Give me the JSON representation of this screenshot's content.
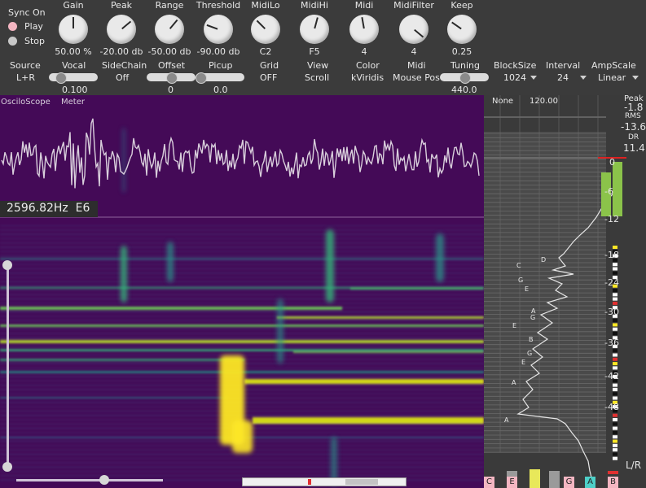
{
  "sync": {
    "title": "Sync On",
    "play": "Play",
    "stop": "Stop"
  },
  "knobs": [
    {
      "name": "Gain",
      "value": "50.00 %",
      "angle": 0
    },
    {
      "name": "Peak",
      "value": "-20.00 db",
      "angle": 50
    },
    {
      "name": "Range",
      "value": "-50.00 db",
      "angle": 40
    },
    {
      "name": "Threshold",
      "value": "-90.00 db",
      "angle": -70
    },
    {
      "name": "MidiLo",
      "value": "C2",
      "angle": -45
    },
    {
      "name": "MidiHi",
      "value": "F5",
      "angle": 15
    },
    {
      "name": "Midi",
      "value": "4",
      "angle": -10
    },
    {
      "name": "MidiFilter",
      "value": "4",
      "angle": 130
    },
    {
      "name": "Keep",
      "value": "0.25",
      "angle": -55
    }
  ],
  "row2": {
    "source_label": "Source",
    "source_value": "L+R",
    "vocal_label": "Vocal",
    "vocal_value": "0.100",
    "vocal_level": 0.1,
    "sidechain_label": "SideChain",
    "sidechain_value": "Off",
    "offset_label": "Offset",
    "offset_value": "0",
    "offset_level": 0.5,
    "picup_label": "Picup",
    "picup_value": "0.0",
    "picup_level": 0.0,
    "grid_label": "Grid",
    "grid_value": "OFF",
    "view_label": "View",
    "view_value": "Scroll",
    "color_label": "Color",
    "color_value": "kViridis",
    "midi_label": "Midi",
    "midi_value": "Mouse Pos",
    "tuning_label": "Tuning",
    "tuning_value": "440.0",
    "tuning_level": 0.5,
    "blocksize_label": "BlockSize",
    "blocksize_value": "1024",
    "interval_label": "Interval",
    "interval_value": "24",
    "ampscale_label": "AmpScale",
    "ampscale_value": "Linear"
  },
  "tabs": {
    "oscilloscope": "OsciloScope",
    "meter": "Meter"
  },
  "readout": "2596.82Hz  E6",
  "meter_header": {
    "none": "None",
    "bpm": "120.00"
  },
  "stats": {
    "peak_label": "Peak",
    "peak_value": "-1.8",
    "rms_label": "RMS",
    "rms_value": "-13.6",
    "dr_label": "DR",
    "dr_value": "11.4"
  },
  "db_scale": [
    "0",
    "-6",
    "-12",
    "-18",
    "-24",
    "-30",
    "-36",
    "-42",
    "-48"
  ],
  "channel_label": "L/R",
  "note_curve_labels": [
    "D",
    "C",
    "G",
    "E",
    "A",
    "G",
    "E",
    "B",
    "G",
    "E",
    "A",
    "A"
  ],
  "note_cells": [
    "C",
    "E",
    "G",
    "A",
    "B"
  ],
  "colors": {
    "spectrum_bg": "#440a57",
    "accent_yellow": "#fde725",
    "meter_green": "#8bc34a",
    "play_radio": "#f4b6c2"
  }
}
